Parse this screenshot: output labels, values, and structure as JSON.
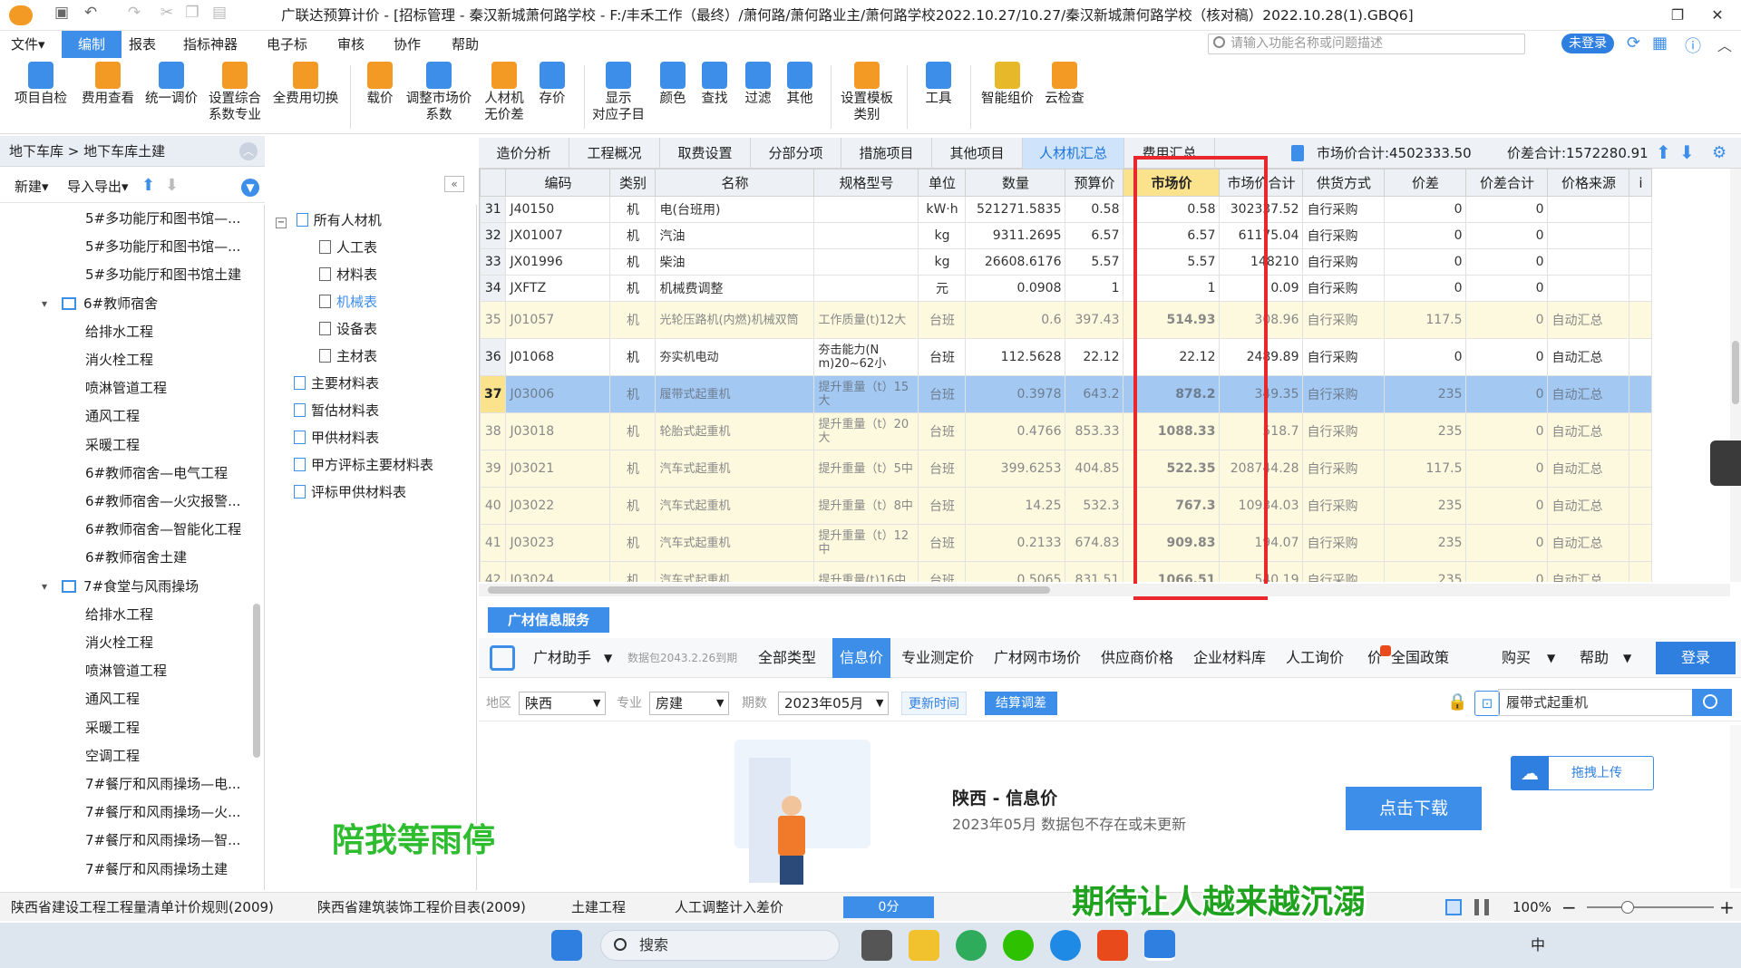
{
  "window": {
    "title": "广联达预算计价 - [招标管理 - 秦汉新城萧何路学校 - F:/丰禾工作（最终）/萧何路/萧何路业主/萧何路学校2022.10.27/10.27/秦汉新城萧何路学校（核对稿）2022.10.28(1).GBQ6]"
  },
  "menu": {
    "items": [
      "文件▾",
      "编制",
      "报表",
      "指标神器",
      "电子标",
      "审核",
      "协作",
      "帮助"
    ],
    "search_placeholder": "请输入功能名称或问题描述",
    "login": "未登录"
  },
  "ribbon": [
    "项目自检",
    "费用查看",
    "统一调价",
    "设置综合\n系数专业",
    "全费用切换",
    "载价",
    "调整市场价\n系数",
    "人材机\n无价差",
    "存价",
    "显示\n对应子目",
    "颜色",
    "查找",
    "过滤",
    "其他",
    "设置模板\n类别",
    "工具",
    "智能组价",
    "云检查"
  ],
  "left_panel": {
    "breadcrumb": "地下车库 > 地下车库土建",
    "new_label": "新建▾",
    "import_label": "导入导出▾",
    "items": [
      {
        "label": "5#多功能厅和图书馆—...",
        "indent": 2
      },
      {
        "label": "5#多功能厅和图书馆—...",
        "indent": 2
      },
      {
        "label": "5#多功能厅和图书馆土建",
        "indent": 2
      },
      {
        "label": "6#教师宿舍",
        "indent": 1,
        "group": true
      },
      {
        "label": "给排水工程",
        "indent": 2
      },
      {
        "label": "消火栓工程",
        "indent": 2
      },
      {
        "label": "喷淋管道工程",
        "indent": 2
      },
      {
        "label": "通风工程",
        "indent": 2
      },
      {
        "label": "采暖工程",
        "indent": 2
      },
      {
        "label": "6#教师宿舍—电气工程",
        "indent": 2
      },
      {
        "label": "6#教师宿舍—火灾报警...",
        "indent": 2
      },
      {
        "label": "6#教师宿舍—智能化工程",
        "indent": 2
      },
      {
        "label": "6#教师宿舍土建",
        "indent": 2
      },
      {
        "label": "7#食堂与风雨操场",
        "indent": 1,
        "group": true
      },
      {
        "label": "给排水工程",
        "indent": 2
      },
      {
        "label": "消火栓工程",
        "indent": 2
      },
      {
        "label": "喷淋管道工程",
        "indent": 2
      },
      {
        "label": "通风工程",
        "indent": 2
      },
      {
        "label": "采暖工程",
        "indent": 2
      },
      {
        "label": "空调工程",
        "indent": 2
      },
      {
        "label": "7#餐厅和风雨操场—电...",
        "indent": 2
      },
      {
        "label": "7#餐厅和风雨操场—火...",
        "indent": 2
      },
      {
        "label": "7#餐厅和风雨操场—智...",
        "indent": 2
      },
      {
        "label": "7#餐厅和风雨操场土建",
        "indent": 2
      }
    ]
  },
  "category_tree": {
    "root": "所有人材机",
    "children": [
      "人工表",
      "材料表",
      "机械表",
      "设备表",
      "主材表"
    ],
    "active": "机械表",
    "others": [
      "主要材料表",
      "暂估材料表",
      "甲供材料表",
      "甲方评标主要材料表",
      "评标甲供材料表"
    ]
  },
  "tabs": {
    "items": [
      "造价分析",
      "工程概况",
      "取费设置",
      "分部分项",
      "措施项目",
      "其他项目",
      "人材机汇总",
      "费用汇总"
    ],
    "active": "人材机汇总",
    "market_total": "市场价合计:4502333.50",
    "diff_total": "价差合计:1572280.91"
  },
  "grid": {
    "columns": [
      "",
      "编码",
      "类别",
      "名称",
      "规格型号",
      "单位",
      "数量",
      "预算价",
      "市场价",
      "市场价合计",
      "供货方式",
      "价差",
      "价差合计",
      "价格来源"
    ],
    "rows": [
      {
        "no": "31",
        "code": "J40150",
        "type": "机",
        "name": "电(台班用)",
        "spec": "",
        "unit": "kW·h",
        "qty": "521271.5835",
        "budget": "0.58",
        "market": "0.58",
        "mtotal": "302337.52",
        "supply": "自行采购",
        "diff": "0",
        "dtotal": "0",
        "source": "",
        "style": "normal"
      },
      {
        "no": "32",
        "code": "JX01007",
        "type": "机",
        "name": "汽油",
        "spec": "",
        "unit": "kg",
        "qty": "9311.2695",
        "budget": "6.57",
        "market": "6.57",
        "mtotal": "61175.04",
        "supply": "自行采购",
        "diff": "0",
        "dtotal": "0",
        "source": "",
        "style": "normal"
      },
      {
        "no": "33",
        "code": "JX01996",
        "type": "机",
        "name": "柴油",
        "spec": "",
        "unit": "kg",
        "qty": "26608.6176",
        "budget": "5.57",
        "market": "5.57",
        "mtotal": "148210",
        "supply": "自行采购",
        "diff": "0",
        "dtotal": "0",
        "source": "",
        "style": "normal"
      },
      {
        "no": "34",
        "code": "JXFTZ",
        "type": "机",
        "name": "机械费调整",
        "spec": "",
        "unit": "元",
        "qty": "0.0908",
        "budget": "1",
        "market": "1",
        "mtotal": "0.09",
        "supply": "自行采购",
        "diff": "0",
        "dtotal": "0",
        "source": "",
        "style": "normal"
      },
      {
        "no": "35",
        "code": "J01057",
        "type": "机",
        "name": "光轮压路机(内燃)机械双筒",
        "spec": "工作质量(t)12大",
        "unit": "台班",
        "qty": "0.6",
        "budget": "397.43",
        "market": "514.93",
        "mtotal": "308.96",
        "supply": "自行采购",
        "diff": "117.5",
        "dtotal": "0",
        "source": "自动汇总",
        "style": "yel"
      },
      {
        "no": "36",
        "code": "J01068",
        "type": "机",
        "name": "夯实机电动",
        "spec": "夯击能力(N m)20~62小",
        "unit": "台班",
        "qty": "112.5628",
        "budget": "22.12",
        "market": "22.12",
        "mtotal": "2489.89",
        "supply": "自行采购",
        "diff": "0",
        "dtotal": "0",
        "source": "自动汇总",
        "style": "plain"
      },
      {
        "no": "37",
        "code": "J03006",
        "type": "机",
        "name": "履带式起重机",
        "spec": "提升重量（t）15大",
        "unit": "台班",
        "qty": "0.3978",
        "budget": "643.2",
        "market": "878.2",
        "mtotal": "349.35",
        "supply": "自行采购",
        "diff": "235",
        "dtotal": "0",
        "source": "自动汇总",
        "style": "sel"
      },
      {
        "no": "38",
        "code": "J03018",
        "type": "机",
        "name": "轮胎式起重机",
        "spec": "提升重量（t）20大",
        "unit": "台班",
        "qty": "0.4766",
        "budget": "853.33",
        "market": "1088.33",
        "mtotal": "518.7",
        "supply": "自行采购",
        "diff": "235",
        "dtotal": "0",
        "source": "自动汇总",
        "style": "yel"
      },
      {
        "no": "39",
        "code": "J03021",
        "type": "机",
        "name": "汽车式起重机",
        "spec": "提升重量（t）5中",
        "unit": "台班",
        "qty": "399.6253",
        "budget": "404.85",
        "market": "522.35",
        "mtotal": "208744.28",
        "supply": "自行采购",
        "diff": "117.5",
        "dtotal": "0",
        "source": "自动汇总",
        "style": "yel"
      },
      {
        "no": "40",
        "code": "J03022",
        "type": "机",
        "name": "汽车式起重机",
        "spec": "提升重量（t）8中",
        "unit": "台班",
        "qty": "14.25",
        "budget": "532.3",
        "market": "767.3",
        "mtotal": "10934.03",
        "supply": "自行采购",
        "diff": "235",
        "dtotal": "0",
        "source": "自动汇总",
        "style": "yel"
      },
      {
        "no": "41",
        "code": "J03023",
        "type": "机",
        "name": "汽车式起重机",
        "spec": "提升重量（t）12中",
        "unit": "台班",
        "qty": "0.2133",
        "budget": "674.83",
        "market": "909.83",
        "mtotal": "194.07",
        "supply": "自行采购",
        "diff": "235",
        "dtotal": "0",
        "source": "自动汇总",
        "style": "yel"
      },
      {
        "no": "42",
        "code": "J03024",
        "type": "机",
        "name": "汽车式起重机",
        "spec": "提升重量(t)16中",
        "unit": "台班",
        "qty": "0.5065",
        "budget": "831.51",
        "market": "1066.51",
        "mtotal": "540.19",
        "supply": "自行采购",
        "diff": "235",
        "dtotal": "0",
        "source": "自动汇总",
        "style": "yel"
      }
    ]
  },
  "guangcai": {
    "tab": "广材信息服务",
    "assistant": "广材助手",
    "package_note": "数据包2043.2.26到期",
    "nav": [
      "全部类型",
      "信息价",
      "专业测定价",
      "广材网市场价",
      "供应商价格",
      "企业材料库",
      "人工询价",
      "价",
      "全国政策",
      "购买",
      "帮助"
    ],
    "active_nav": "信息价",
    "login": "登录",
    "region_label": "地区",
    "region": "陕西",
    "major_label": "专业",
    "major": "房建",
    "period_label": "期数",
    "period": "2023年05月",
    "update_btn": "更新时间",
    "settle_btn": "结算调差",
    "search_value": "履带式起重机",
    "upload_btn": "拖拽上传",
    "info_title": "陕西 - 信息价",
    "info_sub": "2023年05月 数据包不存在或未更新",
    "download_btn": "点击下载"
  },
  "status": {
    "items": [
      "陕西省建设工程工程量清单计价规则(2009)",
      "陕西省建筑装饰工程价目表(2009)",
      "土建工程",
      "人工调整计入差价"
    ],
    "score": "0分",
    "zoom": "100%"
  },
  "taskbar": {
    "search": "搜索",
    "ime": "中"
  },
  "overlays": {
    "caption1": "陪我等雨停",
    "caption2": "期待让人越来越沉溺"
  },
  "colors": {
    "accent": "#3d8ee8",
    "highlight_red": "#e8282c",
    "caption_green": "#1fa31f"
  }
}
